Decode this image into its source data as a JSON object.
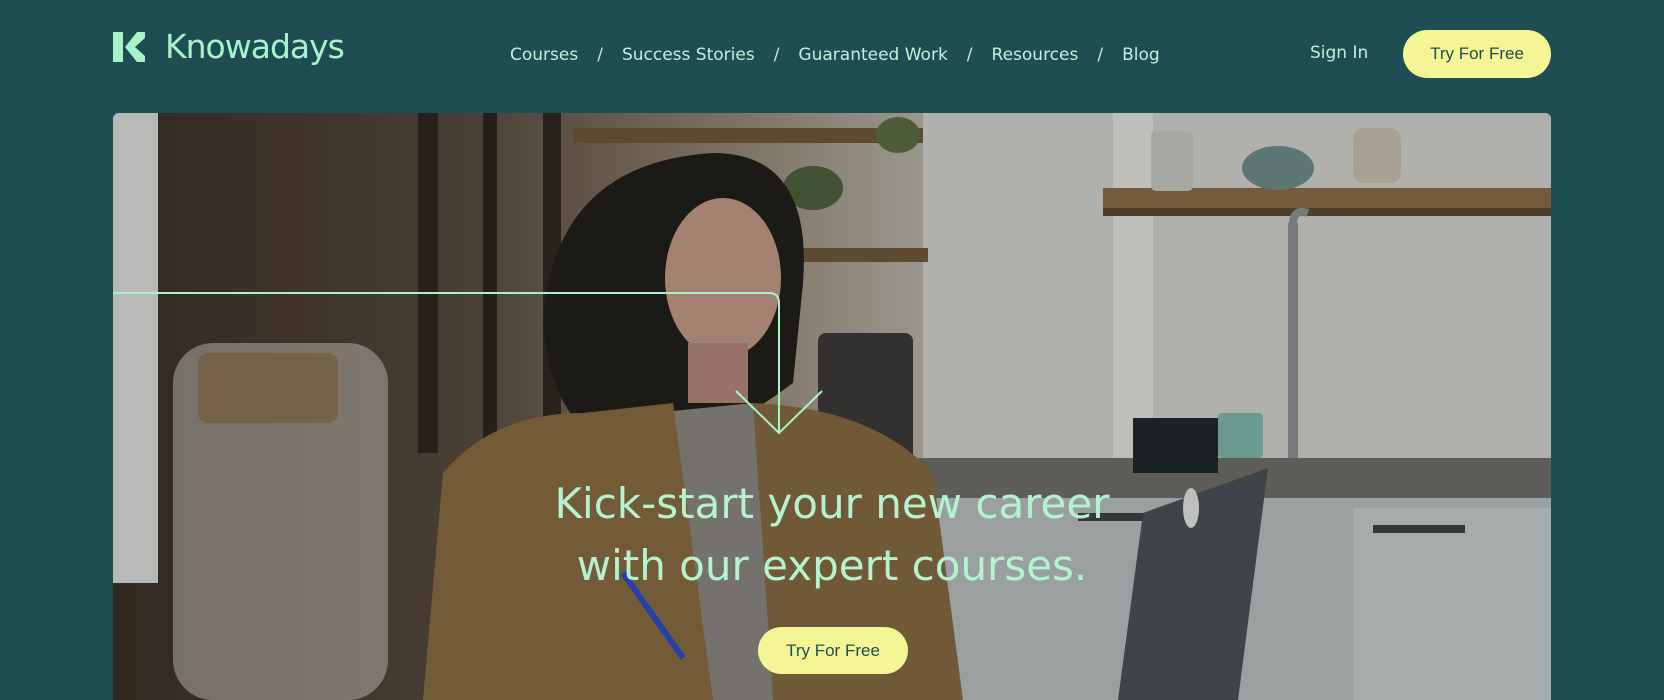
{
  "brand": {
    "name": "Knowadays",
    "logo_icon": "k-logo-icon"
  },
  "nav": {
    "items": [
      {
        "label": "Courses"
      },
      {
        "label": "Success Stories"
      },
      {
        "label": "Guaranteed Work"
      },
      {
        "label": "Resources"
      },
      {
        "label": "Blog"
      }
    ],
    "separator": "/",
    "sign_in": "Sign In",
    "cta": "Try For Free"
  },
  "hero": {
    "headline_line1": "Kick-start your new career",
    "headline_line2": "with our expert courses.",
    "cta": "Try For Free",
    "decoration_icon": "down-arrow-line-icon"
  },
  "colors": {
    "background": "#1f4d54",
    "accent_mint": "#a9f3c9",
    "cta_yellow": "#f4f594",
    "nav_text": "#c9ecdc"
  }
}
